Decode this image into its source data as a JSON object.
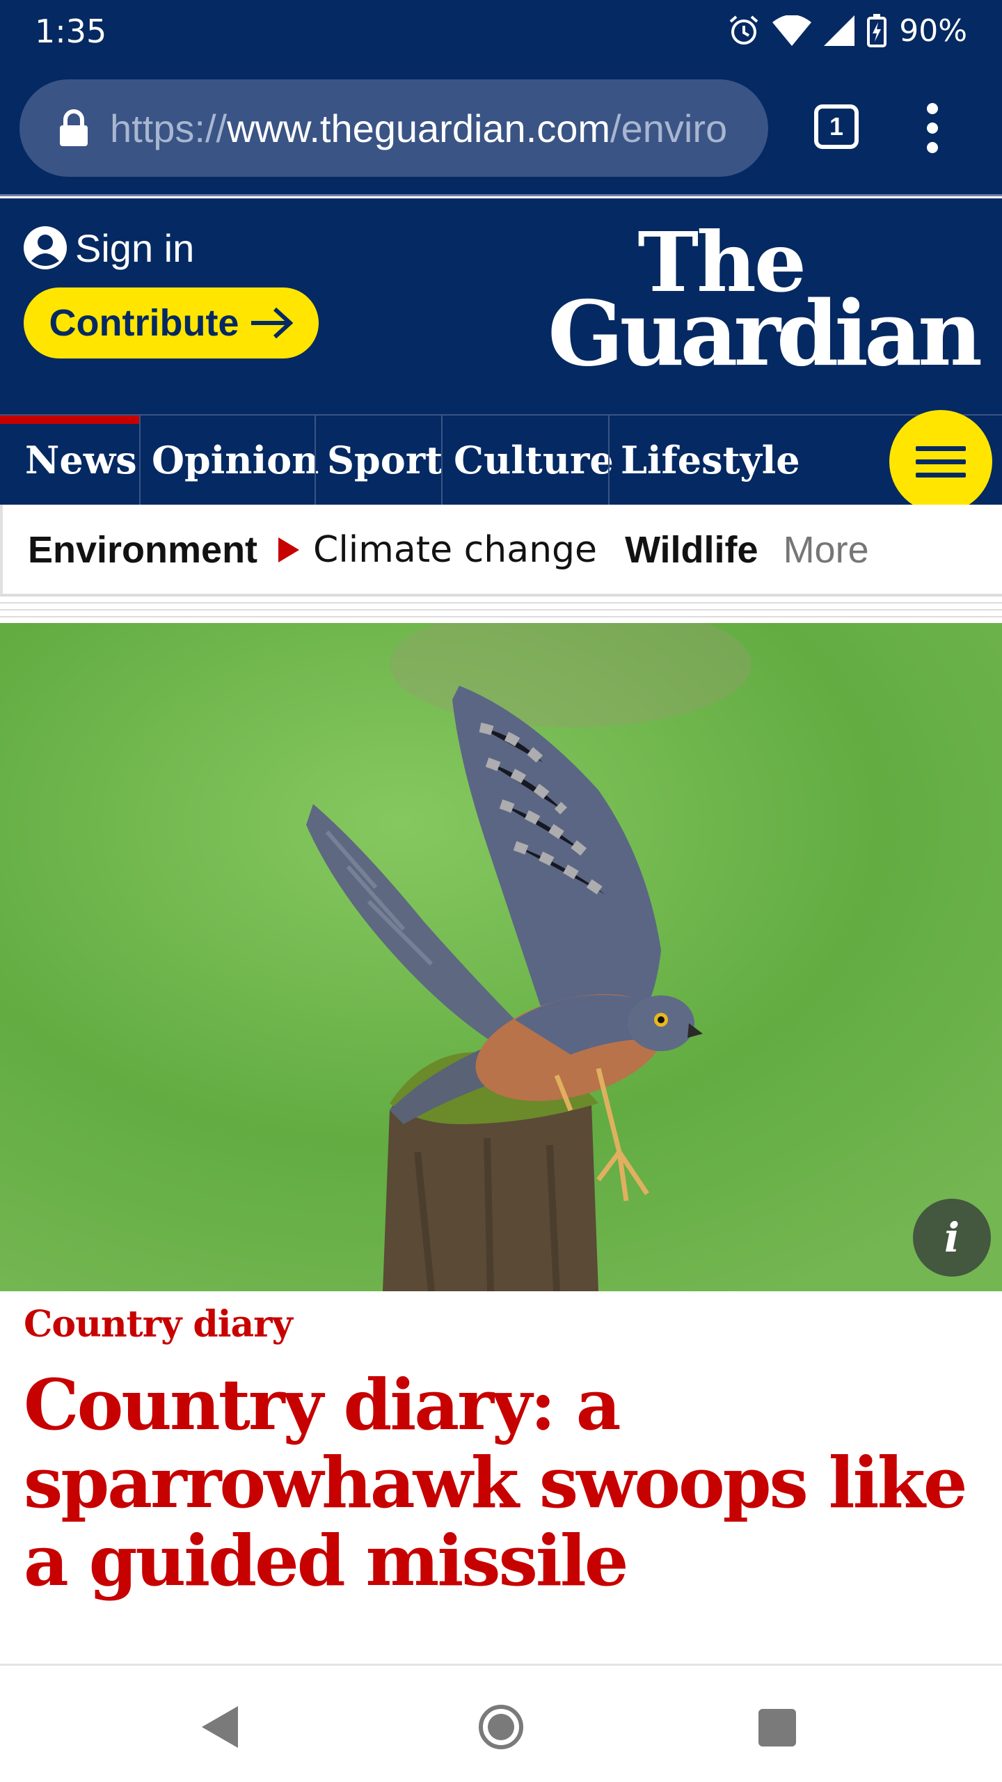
{
  "status_bar": {
    "time": "1:35",
    "battery": "90%",
    "icons": [
      "alarm-icon",
      "wifi-icon",
      "signal-icon",
      "battery-charging-icon"
    ]
  },
  "browser": {
    "url_scheme": "https://",
    "url_host": "www.theguardian.com",
    "url_path": "/enviro",
    "tab_count": "1"
  },
  "header": {
    "sign_in": "Sign in",
    "contribute": "Contribute",
    "logo_line1": "The",
    "logo_line2": "Guardian",
    "brand_color": "#052962",
    "accent_color": "#ffe500"
  },
  "pillars": {
    "items": [
      {
        "label": "News",
        "active": true
      },
      {
        "label": "Opinion",
        "active": false
      },
      {
        "label": "Sport",
        "active": false
      },
      {
        "label": "Culture",
        "active": false
      },
      {
        "label": "Lifestyle",
        "active": false
      }
    ]
  },
  "subnav": {
    "section": "Environment",
    "items": [
      "Climate change",
      "Wildlife",
      "More"
    ]
  },
  "article": {
    "kicker": "Country diary",
    "headline": "Country diary: a sparrowhawk swoops like a guided missile",
    "info_button": "i",
    "headline_color": "#c70000"
  }
}
